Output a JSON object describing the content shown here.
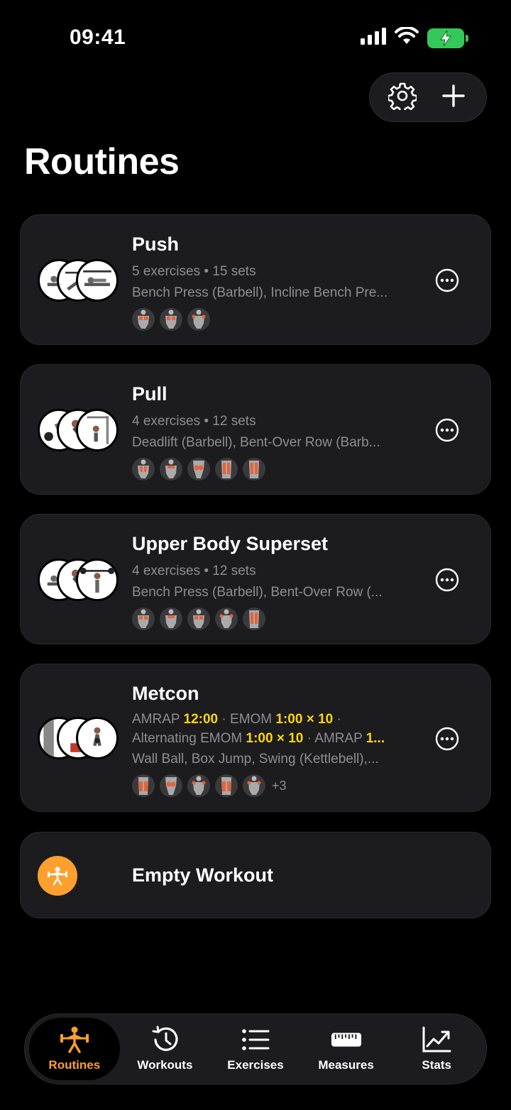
{
  "status_bar": {
    "time": "09:41"
  },
  "header": {
    "title": "Routines"
  },
  "routines": [
    {
      "title": "Push",
      "meta": "5 exercises • 15 sets",
      "exercises": "Bench Press (Barbell), Incline Bench Pre...",
      "muscles": [
        "chest-icon",
        "chest-icon",
        "shoulders-icon"
      ]
    },
    {
      "title": "Pull",
      "meta": "4 exercises • 12 sets",
      "exercises": "Deadlift (Barbell), Bent-Over Row (Barb...",
      "muscles": [
        "back-icon",
        "back-icon",
        "glutes-icon",
        "back-icon",
        "back-icon"
      ]
    },
    {
      "title": "Upper Body Superset",
      "meta": "4 exercises • 12 sets",
      "exercises": "Bench Press (Barbell), Bent-Over Row (...",
      "muscles": [
        "chest-icon",
        "back-icon",
        "chest-icon",
        "shoulders-icon",
        "back-icon"
      ]
    },
    {
      "title": "Metcon",
      "meta_parts": {
        "amrap": "AMRAP",
        "amrap_time": "12:00",
        "emom": "EMOM",
        "emom_time": "1:00 × 10",
        "alt_emom": "Alternating EMOM",
        "alt_emom_time": "1:00 × 10",
        "amrap2": "AMRAP",
        "amrap2_time": "1..."
      },
      "exercises": "Wall Ball, Box Jump, Swing (Kettlebell),...",
      "muscles": [
        "legs-icon",
        "glutes-icon",
        "shoulders-icon",
        "legs-icon",
        "shoulders-icon"
      ],
      "more_muscles": "+3"
    }
  ],
  "empty_workout": {
    "label": "Empty Workout"
  },
  "tabs": [
    {
      "label": "Routines",
      "icon": "barbell-person-icon",
      "active": true
    },
    {
      "label": "Workouts",
      "icon": "history-clock-icon",
      "active": false
    },
    {
      "label": "Exercises",
      "icon": "list-icon",
      "active": false
    },
    {
      "label": "Measures",
      "icon": "ruler-icon",
      "active": false
    },
    {
      "label": "Stats",
      "icon": "chart-line-icon",
      "active": false
    }
  ],
  "colors": {
    "accent": "#ff9f2e",
    "highlight": "#ffd60a",
    "card": "#1c1c1e",
    "battery": "#35c759"
  }
}
